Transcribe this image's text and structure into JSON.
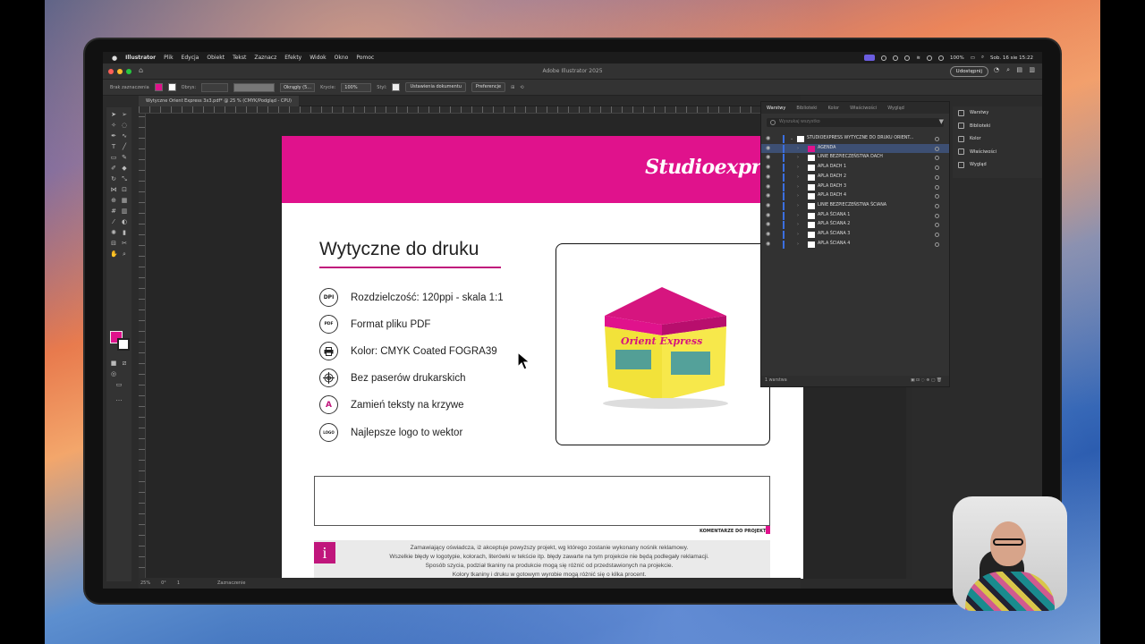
{
  "menubar": {
    "apple": "",
    "app": "Illustrator",
    "items": [
      "Plik",
      "Edycja",
      "Obiekt",
      "Tekst",
      "Zaznacz",
      "Efekty",
      "Widok",
      "Okno",
      "Pomoc"
    ],
    "battery": "100%",
    "datetime": "Sob. 16 sie  15:22"
  },
  "window": {
    "title": "Adobe Illustrator 2025",
    "share_label": "Udostępnij"
  },
  "control_bar": {
    "selection": "Brak zaznaczenia",
    "stroke_label": "Obrys:",
    "brush": "Okrągły (5...",
    "opacity_label": "Krycie:",
    "opacity_value": "100%",
    "style_label": "Styl:",
    "doc_setup": "Ustawienia dokumentu",
    "prefs": "Preferencje"
  },
  "document_tab": "Wytyczne Orient Express 3x3.pdf* @ 25 % (CMYK/Podgląd - CPU)",
  "artboard": {
    "logo": "Studioexpress",
    "heading": "Wytyczne do druku",
    "specs": [
      {
        "icon": "DPI",
        "text": "Rozdzielczość: 120ppi - skala 1:1"
      },
      {
        "icon": "PDF",
        "text": "Format pliku PDF"
      },
      {
        "icon": "",
        "text": "Kolor: CMYK Coated FOGRA39"
      },
      {
        "icon": "",
        "text": "Bez  paserów drukarskich"
      },
      {
        "icon": "A",
        "text": "Zamień teksty na krzywe"
      },
      {
        "icon": "LOGO",
        "text": "Najlepsze logo to wektor"
      }
    ],
    "tent_banner": "Orient Express",
    "comments_label": "KOMENTARZE DO PROJEKTU",
    "info_lines": [
      "Zamawiający oświadcza, iż akceptuje powyższy projekt, wg którego zostanie wykonany nośnik reklamowy.",
      "Wszelkie błędy w logotypie, kolorach, literówki w tekście itp. błędy zawarte na tym projekcie nie będą podlegały reklamacji.",
      "Sposób szycia, podział tkaniny na produkcie mogą się różnić od przedstawionych na projekcie.",
      "Kolory tkaniny i druku w gotowym wyrobie mogą różnić się o kilka procent."
    ]
  },
  "layers_panel": {
    "tabs": [
      "Warstwy",
      "Biblioteki",
      "Kolor",
      "Właściwości",
      "Wygląd"
    ],
    "search_placeholder": "Wyszukaj wszystko",
    "rows": [
      {
        "name": "STUDIOEXPRESS WYTYCZNE DO DRUKU ORIENT...",
        "level": 0,
        "selected": false
      },
      {
        "name": "AGENDA",
        "level": 1,
        "selected": true
      },
      {
        "name": "LINIE BEZPIECZEŃSTWA DACH",
        "level": 1,
        "selected": false
      },
      {
        "name": "APLA DACH 1",
        "level": 1,
        "selected": false
      },
      {
        "name": "APLA DACH 2",
        "level": 1,
        "selected": false
      },
      {
        "name": "APLA DACH 3",
        "level": 1,
        "selected": false
      },
      {
        "name": "APLA DACH 4",
        "level": 1,
        "selected": false
      },
      {
        "name": "LINIE BEZPIECZEŃSTWA ŚCIANA",
        "level": 1,
        "selected": false
      },
      {
        "name": "APLA ŚCIANA 1",
        "level": 1,
        "selected": false
      },
      {
        "name": "APLA ŚCIANA 2",
        "level": 1,
        "selected": false
      },
      {
        "name": "APLA ŚCIANA 3",
        "level": 1,
        "selected": false
      },
      {
        "name": "APLA ŚCIANA 4",
        "level": 1,
        "selected": false
      }
    ],
    "footer": "1 warstwa"
  },
  "right_panels": [
    "Warstwy",
    "Biblioteki",
    "Kolor",
    "Właściwości",
    "Wygląd"
  ],
  "status_bar": {
    "zoom": "25%",
    "rotation": "0°",
    "artboard": "1",
    "mode": "Zaznaczenie"
  },
  "colors": {
    "brand": "#e0128c",
    "selection": "#3b6fe0"
  }
}
